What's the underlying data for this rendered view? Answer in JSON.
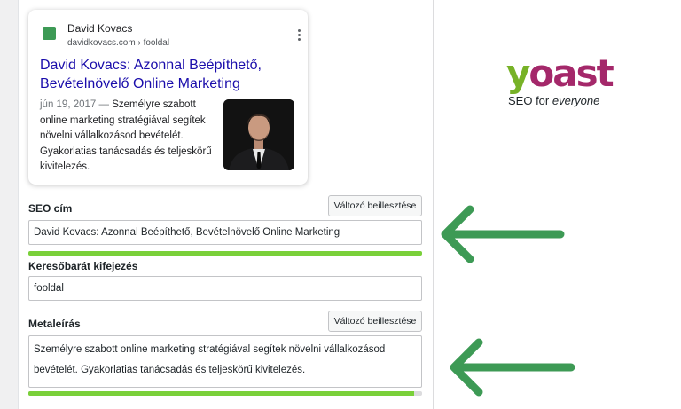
{
  "serp_preview": {
    "site_name": "David Kovacs",
    "site_url": "davidkovacs.com › fooldal",
    "title": "David Kovacs: Azonnal Beépíthető, Bevételnövelő Online Marketing",
    "date": "jún 19, 2017",
    "dash": "—",
    "description": "Személyre szabott online marketing stratégiával segítek növelni vállalkozásod bevételét. Gyakorlatias tanácsadás és teljeskörű kivitelezés.",
    "thumbnail_icon": "portrait-photo"
  },
  "seo_title": {
    "label": "SEO cím",
    "insert_button": "Változó beillesztése",
    "value": "David Kovacs: Azonnal Beépíthető, Bevételnövelő Online Marketing",
    "score_fraction": 1.0
  },
  "focus_keyphrase": {
    "label": "Keresőbarát kifejezés",
    "value": "fooldal"
  },
  "meta_description": {
    "label": "Metaleírás",
    "insert_button": "Változó beillesztése",
    "value": "Személyre szabott online marketing stratégiával segítek növelni vállalkozásod bevételét. Gyakorlatias tanácsadás és teljeskörű kivitelezés.",
    "score_fraction": 0.98
  },
  "branding": {
    "wordmark_y": "y",
    "wordmark_rest": "oast",
    "tagline_prefix": "SEO for",
    "tagline_emphasis": "everyone",
    "colors": {
      "yoast_green": "#77b227",
      "yoast_purple": "#a4286a",
      "arrow_green": "#3d9a55",
      "link_blue": "#1a0dab",
      "progress_green": "#7ad03a"
    }
  }
}
